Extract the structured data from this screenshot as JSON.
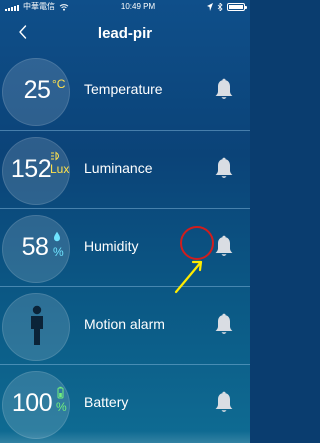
{
  "status_bar": {
    "carrier": "中華電信",
    "time": "10:49 PM",
    "battery_level": 1
  },
  "header": {
    "title": "lead-pir",
    "back_icon": "chevron-left-icon"
  },
  "sensors": [
    {
      "value": "25",
      "unit": "°C",
      "label": "Temperature",
      "icon": "bell-icon"
    },
    {
      "value": "152",
      "unit": "Lux",
      "label": "Luminance",
      "icon": "bell-icon"
    },
    {
      "value": "58",
      "unit": "%",
      "label": "Humidity",
      "icon": "bell-icon"
    },
    {
      "value": "",
      "unit": "",
      "label": "Motion alarm",
      "icon": "bell-icon"
    },
    {
      "value": "100",
      "unit": "%",
      "label": "Battery",
      "icon": "bell-icon"
    }
  ],
  "colors": {
    "accent": "#ffe14d",
    "highlight": "#d11d1d",
    "arrow": "#ffeb00"
  }
}
